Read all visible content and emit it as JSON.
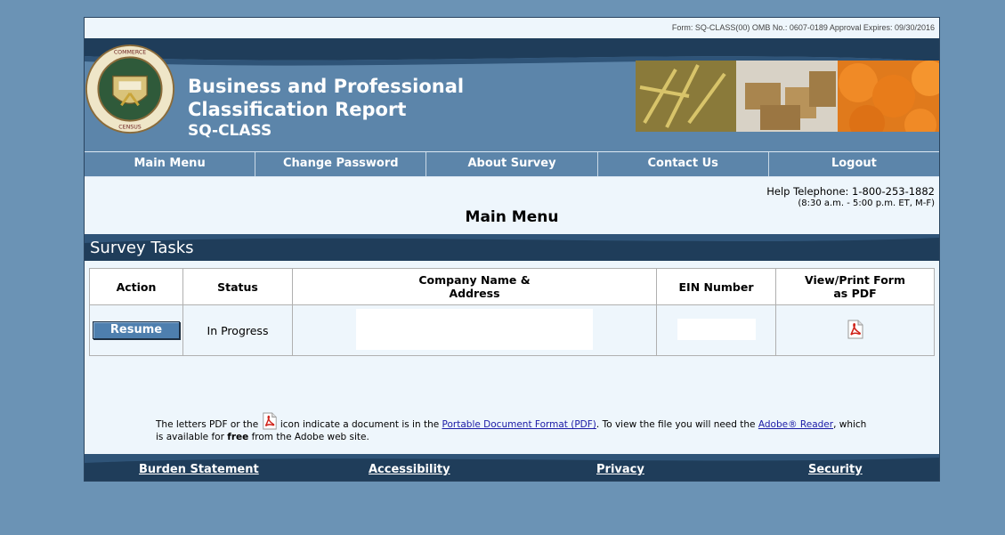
{
  "form_info": "Form: SQ-CLASS(00) OMB No.: 0607-0189 Approval Expires: 09/30/2016",
  "seal": {
    "top_text": "U.S. DEPARTMENT OF COMMERCE",
    "bottom_text": "BUREAU OF THE CENSUS"
  },
  "header": {
    "title_line1": "Business and Professional",
    "title_line2": "Classification Report",
    "subtitle": "SQ-CLASS"
  },
  "nav": [
    {
      "label": "Main Menu"
    },
    {
      "label": "Change Password"
    },
    {
      "label": "About Survey"
    },
    {
      "label": "Contact Us"
    },
    {
      "label": "Logout"
    }
  ],
  "help": {
    "telephone": "Help Telephone: 1-800-253-1882",
    "hours": "(8:30 a.m. - 5:00 p.m. ET, M-F)"
  },
  "page_title": "Main Menu",
  "tasks_header": "Survey Tasks",
  "table": {
    "headers": {
      "action": "Action",
      "status": "Status",
      "company_line1": "Company Name &",
      "company_line2": "Address",
      "ein": "EIN Number",
      "view_line1": "View/Print Form",
      "view_line2": "as PDF"
    },
    "rows": [
      {
        "action": "Resume",
        "status": "In Progress",
        "company": "",
        "ein": ""
      }
    ]
  },
  "note": {
    "part1": "The letters PDF or the",
    "part2": "icon indicate a document is in the",
    "link1": "Portable Document Format (PDF)",
    "part3": ". To view the file you will need the",
    "link2": "Adobe® Reader",
    "part4": ", which is available for",
    "bold": "free",
    "part5": "from the Adobe web site."
  },
  "footer": [
    {
      "label": "Burden Statement"
    },
    {
      "label": "Accessibility"
    },
    {
      "label": "Privacy"
    },
    {
      "label": "Security"
    }
  ],
  "colors": {
    "background": "#6b93b5",
    "banner": "#5c85aa",
    "dark_band": "#1f3d5a",
    "content": "#eef6fc",
    "button": "#4e7fae"
  }
}
